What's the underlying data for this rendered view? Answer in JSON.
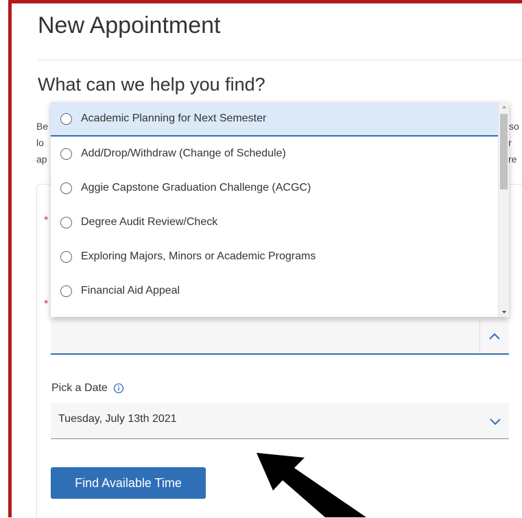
{
  "header": {
    "title": "New Appointment"
  },
  "section": {
    "title": "What can we help you find?",
    "intro_fragments": [
      "Be",
      "lo",
      "ap",
      "so",
      "r re"
    ]
  },
  "service_dropdown": {
    "options": [
      "Academic Planning for Next Semester",
      "Add/Drop/Withdraw (Change of Schedule)",
      "Aggie Capstone Graduation Challenge (ACGC)",
      "Degree Audit Review/Check",
      "Exploring Majors, Minors or Academic Programs",
      "Financial Aid Appeal"
    ],
    "highlighted_index": 0,
    "expanded": true
  },
  "date_field": {
    "label": "Pick a Date",
    "value": "Tuesday, July 13th 2021"
  },
  "actions": {
    "find_label": "Find Available Time"
  },
  "colors": {
    "accent": "#2f6fb6",
    "frame": "#b31b1b",
    "highlight": "#dbe9f9",
    "required": "#c0392b"
  },
  "icons": {
    "info": "info-icon",
    "chevron_up": "chevron-up-icon",
    "chevron_down": "chevron-down-icon"
  }
}
